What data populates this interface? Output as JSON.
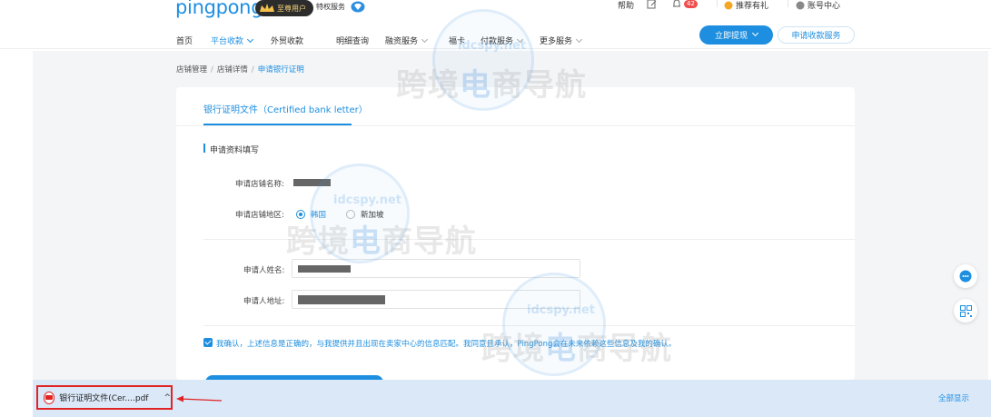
{
  "brand": {
    "logo_text": "pingpong",
    "vip_label": "至尊用户",
    "privilege_label": "特权服务"
  },
  "top_right": {
    "help": "帮助",
    "notifications_count": "42",
    "referral": "推荐有礼",
    "account_center": "账号中心"
  },
  "nav": {
    "items": [
      {
        "label": "首页",
        "dropdown": false,
        "active": false
      },
      {
        "label": "平台收款",
        "dropdown": true,
        "active": true
      },
      {
        "label": "外贸收款",
        "dropdown": false,
        "active": false
      },
      {
        "label": "明细查询",
        "dropdown": false,
        "active": false
      },
      {
        "label": "融资服务",
        "dropdown": true,
        "active": false
      },
      {
        "label": "福卡",
        "dropdown": false,
        "active": false
      },
      {
        "label": "付款服务",
        "dropdown": true,
        "active": false
      },
      {
        "label": "更多服务",
        "dropdown": true,
        "active": false
      }
    ],
    "withdraw_label": "立即提现",
    "apply_service_label": "申请收款服务"
  },
  "breadcrumb": [
    "店铺管理",
    "店铺详情",
    "申请银行证明"
  ],
  "tab": {
    "title": "银行证明文件（Certified bank letter）"
  },
  "section": {
    "title": "申请资料填写"
  },
  "form": {
    "store_name_label": "申请店铺名称:",
    "store_region_label": "申请店铺地区:",
    "region_options": [
      {
        "label": "韩国",
        "selected": true
      },
      {
        "label": "新加坡",
        "selected": false
      }
    ],
    "applicant_name_label": "申请人姓名:",
    "applicant_address_label": "申请人地址:",
    "confirm_text": "我确认，上述信息是正确的，与我提供并且出现在卖家中心的信息匹配。我同意且承认，PingPong会在未来依赖这些信息及我的确认。",
    "confirm_checked": true
  },
  "watermark": {
    "text_1": "跨境",
    "text_2": "电",
    "text_3": "商导航",
    "url": "idcspy.net"
  },
  "download_bar": {
    "file_name": "银行证明文件(Cer....pdf",
    "file_icon": "pdf-icon",
    "show_all_label": "全部显示"
  },
  "colors": {
    "accent": "#1e8fe0",
    "highlight_box": "#e02424",
    "download_bar_bg": "#dbe8f8"
  }
}
